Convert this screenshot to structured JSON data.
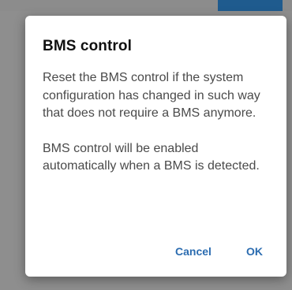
{
  "dialog": {
    "title": "BMS control",
    "paragraphs": [
      "Reset the BMS control if the system configuration has changed in such way that does not require a BMS anymore.",
      "BMS control will be enabled automatically when a BMS is detected."
    ],
    "cancel_label": "Cancel",
    "ok_label": "OK"
  },
  "colors": {
    "accent": "#2b6cb0",
    "overlay": "#8e8e8e",
    "dialog_bg": "#ffffff",
    "title": "#111111",
    "body_text": "#4a4a4a",
    "top_bar_accent": "#1f5b8e"
  }
}
